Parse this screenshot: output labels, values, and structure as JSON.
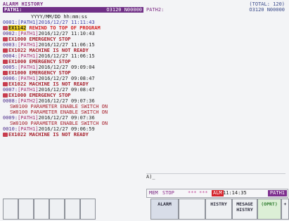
{
  "header": {
    "title": "ALARM HISTORY",
    "total": "(TOTAL: 120)",
    "path1": {
      "name": "PATH1:",
      "info": "O3120 N00000"
    },
    "path2": {
      "name": "PATH2:",
      "info": "O3120 N00000"
    },
    "column_format": "YYYY/MM/DD hh:mm:ss"
  },
  "log": [
    {
      "type": "entry",
      "index": "0001:",
      "path": "[PATH1]",
      "datetime": "2016/12/27  11:11:43"
    },
    {
      "type": "alarm",
      "code": "EX1142",
      "message": "REWIND TO TOP OF PROGRAM",
      "selected": true
    },
    {
      "type": "entry",
      "index": "0002:",
      "path": "[PATH1]",
      "datetime": "2016/12/27  11:10:43"
    },
    {
      "type": "alarm",
      "code": "EX1000",
      "message": "EMERGENCY STOP"
    },
    {
      "type": "entry",
      "index": "0003:",
      "path": "[PATH1]",
      "datetime": "2016/12/27  11:06:15"
    },
    {
      "type": "alarm",
      "code": "EX1022",
      "message": "MACHINE IS NOT READY"
    },
    {
      "type": "entry",
      "index": "0004:",
      "path": "[PATH1]",
      "datetime": "2016/12/27  11:06:15"
    },
    {
      "type": "alarm",
      "code": "EX1000",
      "message": "EMERGENCY STOP"
    },
    {
      "type": "entry",
      "index": "0005:",
      "path": "[PATH1]",
      "datetime": "2016/12/27  09:09:04"
    },
    {
      "type": "alarm",
      "code": "EX1000",
      "message": "EMERGENCY STOP"
    },
    {
      "type": "entry",
      "index": "0006:",
      "path": "[PATH1]",
      "datetime": "2016/12/27  09:08:47"
    },
    {
      "type": "alarm",
      "code": "EX1022",
      "message": "MACHINE IS NOT READY"
    },
    {
      "type": "entry",
      "index": "0007:",
      "path": "[PATH1]",
      "datetime": "2016/12/27  09:08:47"
    },
    {
      "type": "alarm",
      "code": "EX1000",
      "message": "EMERGENCY STOP"
    },
    {
      "type": "entry",
      "index": "0008:",
      "path": "[PATH2]",
      "datetime": "2016/12/27  09:07:36"
    },
    {
      "type": "sub",
      "message": "SW0100 PARAMETER ENABLE SWITCH ON"
    },
    {
      "type": "sub",
      "message": "SW0100 PARAMETER ENABLE SWITCH ON"
    },
    {
      "type": "entry",
      "index": "0009:",
      "path": "[PATH1]",
      "datetime": "2016/12/27  09:07:36"
    },
    {
      "type": "sub",
      "message": "SW0100 PARAMETER ENABLE SWITCH ON"
    },
    {
      "type": "entry",
      "index": "0010:",
      "path": "[PATH1]",
      "datetime": "2016/12/27  09:06:59"
    },
    {
      "type": "alarm",
      "code": "EX1022",
      "message": "MACHINE IS NOT READY"
    }
  ],
  "input": {
    "prompt": "A)_"
  },
  "status": {
    "mode": "MEM",
    "op": "STOP",
    "dash1": "***",
    "dash2": "***",
    "alarm": "ALM",
    "time": "11:14:35",
    "path": "PATH1"
  },
  "softkeys": [
    "",
    "",
    "",
    "",
    "",
    "",
    "ALARM",
    "",
    "HISTRY",
    "MESAGE HISTRY",
    "(OPRT)",
    "+"
  ],
  "colors": {
    "header_bar": "#6f2f86",
    "alarm_text": "#a61e2a",
    "alarm_badge": "#c83d4e",
    "selected_highlight": "#f0d020",
    "alm_indicator": "#d4242c"
  }
}
